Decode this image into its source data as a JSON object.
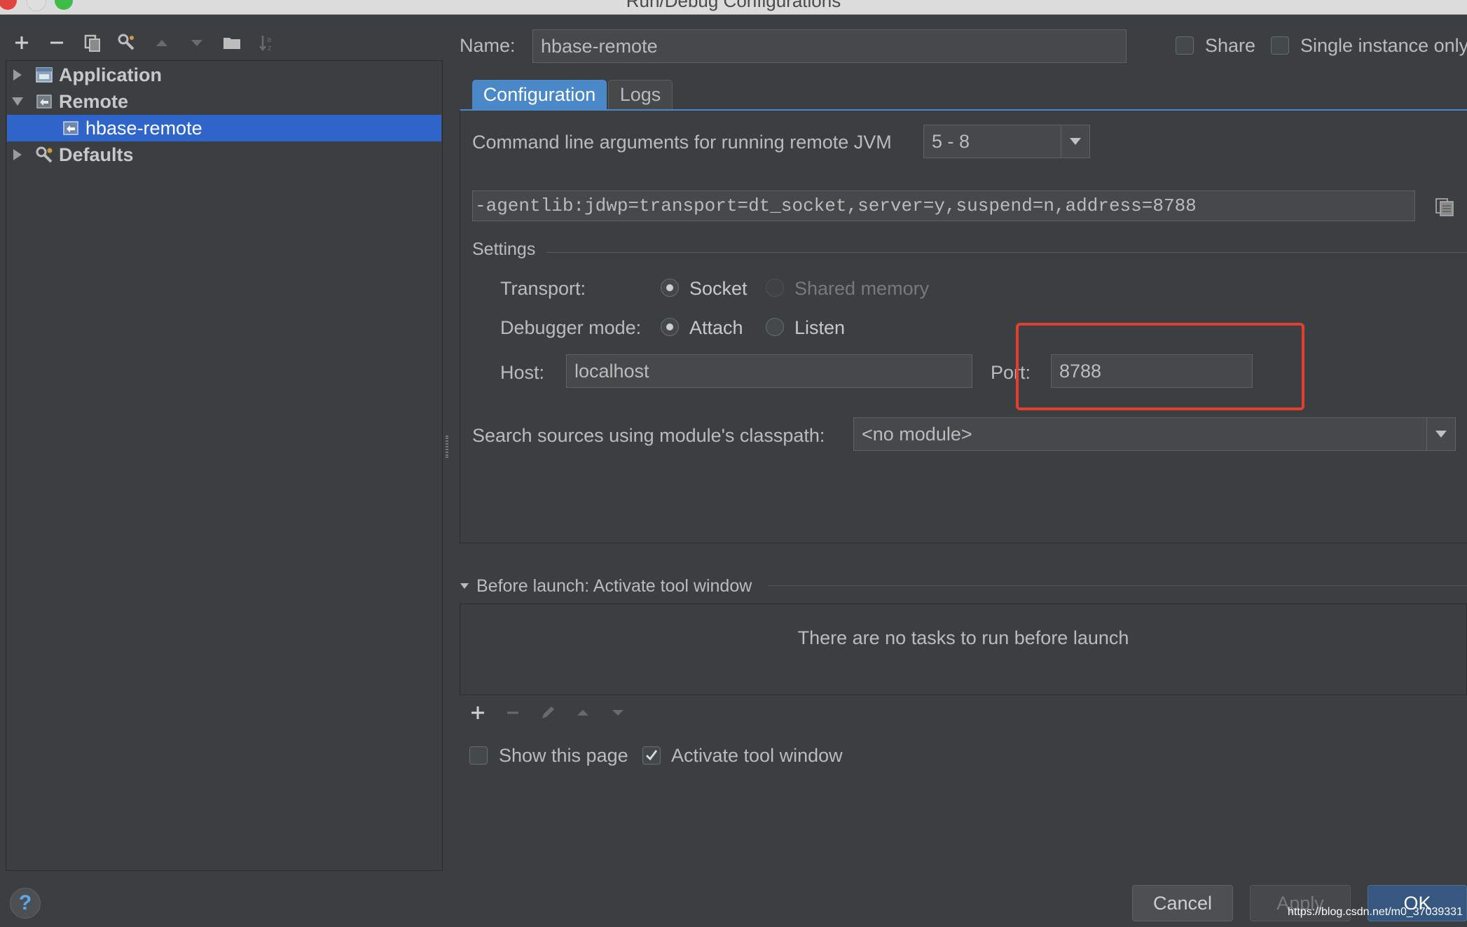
{
  "window": {
    "title": "Run/Debug Configurations"
  },
  "toolbar": {
    "icons": [
      "add-icon",
      "remove-icon",
      "copy-icon",
      "edit-defaults-icon",
      "move-up-icon",
      "move-down-icon",
      "folder-icon",
      "sort-icon"
    ]
  },
  "tree": {
    "items": [
      {
        "label": "Application",
        "expanded": false,
        "icon": "application-icon"
      },
      {
        "label": "Remote",
        "expanded": true,
        "icon": "remote-icon"
      },
      {
        "label": "hbase-remote",
        "selected": true,
        "icon": "remote-config-icon"
      },
      {
        "label": "Defaults",
        "expanded": false,
        "icon": "defaults-icon"
      }
    ]
  },
  "name": {
    "label": "Name:",
    "value": "hbase-remote"
  },
  "share": {
    "label": "Share",
    "checked": false
  },
  "single_instance": {
    "label": "Single instance only",
    "checked": false
  },
  "tabs": [
    {
      "label": "Configuration",
      "active": true
    },
    {
      "label": "Logs",
      "active": false
    }
  ],
  "jvm": {
    "label": "Command line arguments for running remote JVM",
    "version": "5 - 8",
    "args": "-agentlib:jdwp=transport=dt_socket,server=y,suspend=n,address=8788"
  },
  "settings": {
    "title": "Settings",
    "transport_label": "Transport:",
    "transport_options": [
      {
        "label": "Socket",
        "selected": true,
        "enabled": true
      },
      {
        "label": "Shared memory",
        "selected": false,
        "enabled": false
      }
    ],
    "mode_label": "Debugger mode:",
    "mode_options": [
      {
        "label": "Attach",
        "selected": true
      },
      {
        "label": "Listen",
        "selected": false
      }
    ],
    "host_label": "Host:",
    "host_value": "localhost",
    "port_label": "Port:",
    "port_value": "8788"
  },
  "classpath": {
    "label": "Search sources using module's classpath:",
    "value": "<no module>"
  },
  "before_launch": {
    "title": "Before launch: Activate tool window",
    "empty_text": "There are no tasks to run before launch"
  },
  "options": {
    "show_page": {
      "label": "Show this page",
      "checked": false
    },
    "activate_tool_window": {
      "label": "Activate tool window",
      "checked": true
    }
  },
  "buttons": {
    "help": "?",
    "cancel": "Cancel",
    "apply": "Apply",
    "ok": "OK"
  },
  "watermark": "https://blog.csdn.net/m0_37039331",
  "colors": {
    "background": "#3c3f41",
    "selection": "#2f65ca",
    "highlight_box": "#e1402e",
    "tab_active": "#4a88c7",
    "ok_button": "#365880"
  }
}
